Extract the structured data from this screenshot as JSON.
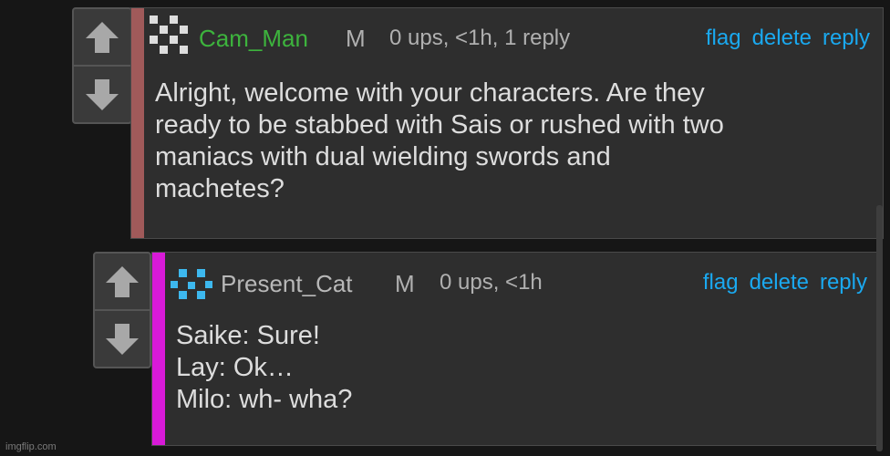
{
  "colors": {
    "background": "#161616",
    "comment_bg": "#2e2e2e",
    "link": "#1aa9f0",
    "stripe_first": "#a05a5a",
    "stripe_second": "#d81ad8",
    "username_first": "#3db33d",
    "username_second": "#b8b8b8"
  },
  "comments": [
    {
      "avatar_icon": "pixel-avatar-icon",
      "username": "Cam_Man",
      "badge": "M",
      "meta": "0 ups, <1h, 1 reply",
      "actions": {
        "flag": "flag",
        "delete": "delete",
        "reply": "reply"
      },
      "lines": [
        "Alright, welcome with your characters. Are they",
        "ready to be stabbed with Sais or rushed with two",
        "maniacs with dual wielding swords and",
        "machetes?"
      ]
    },
    {
      "avatar_icon": "pixel-avatar-icon",
      "username": "Present_Cat",
      "badge": "M",
      "meta": "0 ups, <1h",
      "actions": {
        "flag": "flag",
        "delete": "delete",
        "reply": "reply"
      },
      "lines": [
        "Saike: Sure!",
        "Lay: Ok…",
        "Milo: wh- wha?"
      ]
    }
  ],
  "watermark": "imgflip.com"
}
